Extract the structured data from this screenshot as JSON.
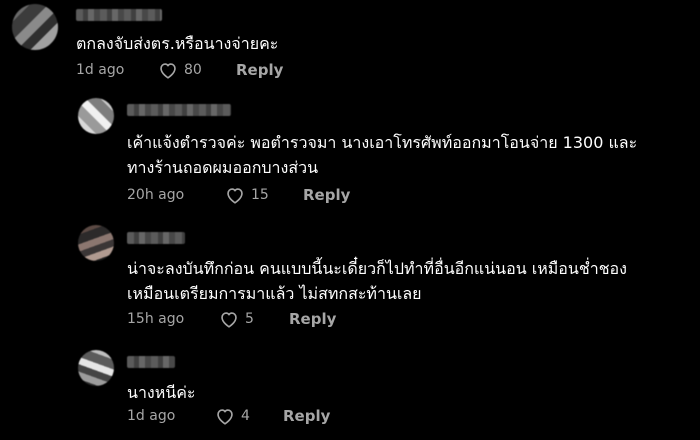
{
  "comments": [
    {
      "text_lines": [
        "ตกลงจับส่งตร.หรือนางจ่ายคะ"
      ],
      "time": "1d ago",
      "likes": "80",
      "reply_label": "Reply"
    },
    {
      "text_lines": [
        "เค้าแจ้งตำรวจค่ะ พอตำรวจมา นางเอาโทรศัพท์ออกมาโอนจ่าย 1300 และ",
        "ทางร้านถอดผมออกบางส่วน"
      ],
      "time": "20h ago",
      "likes": "15",
      "reply_label": "Reply"
    },
    {
      "text_lines": [
        "น่าจะลงบันทึกก่อน คนแบบนี้นะเดี๋ยวก็ไปทำที่อื่นอีกแน่นอน เหมือนช่ำชอง",
        "เหมือนเตรียมการมาแล้ว ไม่สทกสะท้านเลย"
      ],
      "time": "15h ago",
      "likes": "5",
      "reply_label": "Reply"
    },
    {
      "text_lines": [
        "นางหนีค่ะ"
      ],
      "time": "1d ago",
      "likes": "4",
      "reply_label": "Reply"
    }
  ],
  "icons": {
    "like": "heart-outline-icon"
  },
  "colors": {
    "background": "#000000",
    "text": "#ffffff",
    "meta": "#a6a6a6"
  }
}
